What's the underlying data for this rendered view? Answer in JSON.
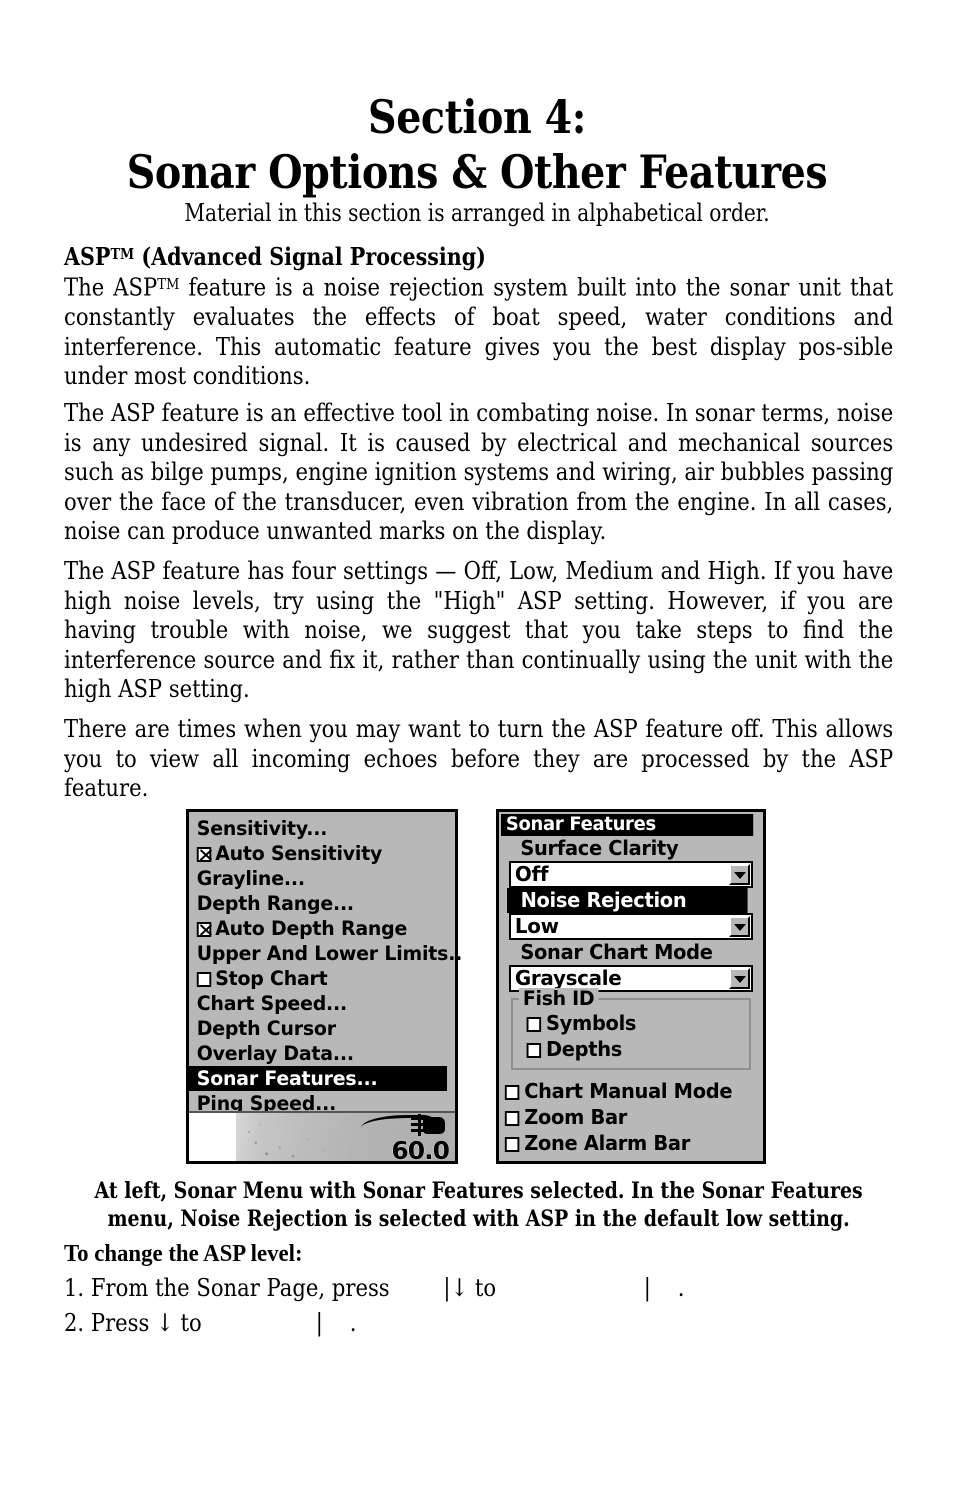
{
  "document": {
    "section_line1": "Section 4:",
    "section_line2": "Sonar Options & Other Features",
    "subtitle": "Material in this section is arranged in alphabetical order.",
    "heading_asp": "ASP™ (Advanced Signal Processing)",
    "paragraph_1": "The ASP™ feature is a noise rejection system built into the sonar unit that constantly evaluates the effects of boat speed, water conditions and interference. This automatic feature gives you the best display pos-sible under most conditions.",
    "paragraph_2": "The ASP feature is an effective tool in combating noise. In sonar terms, noise is any undesired signal. It is caused by electrical and mechanical sources such as bilge pumps, engine ignition systems and wiring, air bubbles passing over the face of the transducer, even vibration from the engine. In all cases, noise can produce unwanted marks on the display.",
    "paragraph_3": "The ASP feature has four settings — Off, Low, Medium and High. If you have high noise levels, try using the \"High\" ASP setting. However, if you are having trouble with noise, we suggest that you take steps to find the interference source and fix it, rather than continually using the unit with the high ASP setting.",
    "paragraph_4": "There are times when you may want to turn the ASP feature off. This allows you to view all incoming echoes before they are processed by the ASP feature.",
    "figure_caption": "At left, Sonar Menu with Sonar Features selected. In the Sonar Features menu, Noise Rejection is selected with ASP in the default low setting.",
    "heading_procedure": "To change the ASP level:",
    "step_1": "1. From the Sonar Page, press        |↓ to                      |    .",
    "step_2": "2. Press ↓ to                 |    ."
  },
  "sonar_menu": {
    "items": [
      {
        "label": "Sensitivity...",
        "checkbox": "none",
        "selected": false
      },
      {
        "label": "Auto Sensitivity",
        "checkbox": "checked",
        "selected": false
      },
      {
        "label": "Grayline...",
        "checkbox": "none",
        "selected": false
      },
      {
        "label": "Depth Range...",
        "checkbox": "none",
        "selected": false
      },
      {
        "label": "Auto Depth Range",
        "checkbox": "checked",
        "selected": false
      },
      {
        "label": "Upper And Lower Limits..",
        "checkbox": "none",
        "selected": false
      },
      {
        "label": "Stop Chart",
        "checkbox": "unchecked",
        "selected": false
      },
      {
        "label": "Chart Speed...",
        "checkbox": "none",
        "selected": false
      },
      {
        "label": "Depth Cursor",
        "checkbox": "none",
        "selected": false
      },
      {
        "label": "Overlay Data...",
        "checkbox": "none",
        "selected": false
      },
      {
        "label": "Sonar Features...",
        "checkbox": "none",
        "selected": true
      },
      {
        "label": "Ping Speed...",
        "checkbox": "none",
        "selected": false
      }
    ],
    "sonar_strip": {
      "depth_reading": "60.0"
    }
  },
  "sonar_features": {
    "title": "Sonar Features",
    "fields": [
      {
        "label": "Surface Clarity",
        "value": "Off",
        "highlighted": false
      },
      {
        "label": "Noise Rejection",
        "value": "Low",
        "highlighted": true
      },
      {
        "label": "Sonar Chart Mode",
        "value": "Grayscale",
        "highlighted": false
      }
    ],
    "fish_id": {
      "legend": "Fish ID",
      "options": [
        {
          "label": "Symbols",
          "checked": false
        },
        {
          "label": "Depths",
          "checked": false
        }
      ]
    },
    "bottom_options": [
      {
        "label": "Chart Manual Mode",
        "checked": false
      },
      {
        "label": "Zoom Bar",
        "checked": false
      },
      {
        "label": "Zone Alarm Bar",
        "checked": false
      }
    ]
  }
}
